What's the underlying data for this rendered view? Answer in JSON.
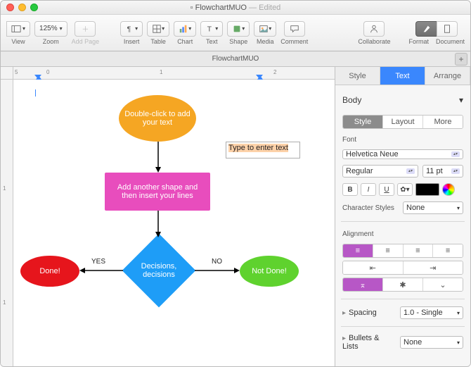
{
  "titlebar": {
    "doc_name": "FlowchartMUO",
    "status": "Edited"
  },
  "toolbar": {
    "view": "View",
    "zoom_value": "125%",
    "zoom": "Zoom",
    "add_page": "Add Page",
    "insert": "Insert",
    "table": "Table",
    "chart": "Chart",
    "text": "Text",
    "shape": "Shape",
    "media": "Media",
    "comment": "Comment",
    "collaborate": "Collaborate",
    "format": "Format",
    "document": "Document"
  },
  "tabbar": {
    "doc_tab": "FlowchartMUO"
  },
  "ruler": {
    "h": [
      "5",
      "0",
      "1",
      "2"
    ],
    "v": [
      "1",
      "1"
    ]
  },
  "flowchart": {
    "start": "Double-click to add your text",
    "process": "Add another shape and then insert your lines",
    "decision": "Decisions, decisions",
    "done": "Done!",
    "not_done": "Not Done!",
    "yes": "YES",
    "no": "NO",
    "textbox": "Type to enter text"
  },
  "inspector": {
    "tabs": {
      "style": "Style",
      "text": "Text",
      "arrange": "Arrange"
    },
    "para_style": "Body",
    "seg": {
      "style": "Style",
      "layout": "Layout",
      "more": "More"
    },
    "font_label": "Font",
    "font_family": "Helvetica Neue",
    "font_weight": "Regular",
    "font_size": "11 pt",
    "bold": "B",
    "italic": "I",
    "underline": "U",
    "char_styles_label": "Character Styles",
    "char_styles_value": "None",
    "alignment_label": "Alignment",
    "spacing_label": "Spacing",
    "spacing_value": "1.0 - Single",
    "bullets_label": "Bullets & Lists",
    "bullets_value": "None"
  },
  "colors": {
    "orange": "#f5a623",
    "pink": "#e84dbd",
    "blue": "#1e9df7",
    "red": "#e6151c",
    "green": "#5fd22e",
    "accent": "#b757c6"
  }
}
